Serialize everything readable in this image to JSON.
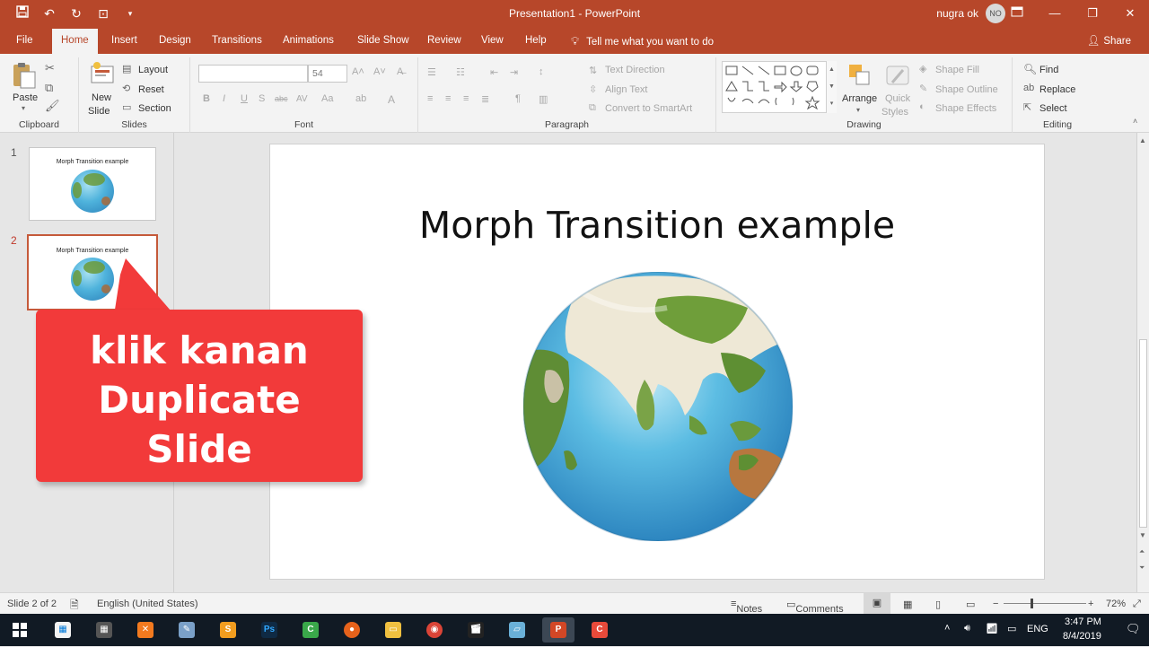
{
  "window": {
    "title": "Presentation1  -  PowerPoint",
    "user_name": "nugra ok",
    "user_initials": "NO"
  },
  "tabs": {
    "items": [
      "File",
      "Home",
      "Insert",
      "Design",
      "Transitions",
      "Animations",
      "Slide Show",
      "Review",
      "View",
      "Help"
    ],
    "active": "Home",
    "tell_me": "Tell me what you want to do",
    "share": "Share"
  },
  "ribbon": {
    "clipboard": {
      "label": "Clipboard",
      "paste": "Paste"
    },
    "slides": {
      "label": "Slides",
      "new_slide_1": "New",
      "new_slide_2": "Slide",
      "layout": "Layout",
      "reset": "Reset",
      "section": "Section"
    },
    "font": {
      "label": "Font",
      "font_name": "",
      "font_size": "54"
    },
    "paragraph": {
      "label": "Paragraph",
      "text_direction": "Text Direction",
      "align_text": "Align Text",
      "smartart": "Convert to SmartArt"
    },
    "drawing": {
      "label": "Drawing",
      "arrange": "Arrange",
      "quick_1": "Quick",
      "quick_2": "Styles",
      "shape_fill": "Shape Fill",
      "shape_outline": "Shape Outline",
      "shape_effects": "Shape Effects"
    },
    "editing": {
      "label": "Editing",
      "find": "Find",
      "replace": "Replace",
      "select": "Select"
    }
  },
  "thumbnails": [
    {
      "number": "1",
      "title": "Morph Transition example",
      "selected": false
    },
    {
      "number": "2",
      "title": "Morph Transition example",
      "selected": true
    }
  ],
  "slide": {
    "title": "Morph Transition example"
  },
  "callout": {
    "text": "klik kanan\nDuplicate\nSlide",
    "color": "#f23a3a"
  },
  "status": {
    "slide_pos": "Slide 2 of 2",
    "language": "English (United States)",
    "notes": "Notes",
    "comments": "Comments",
    "zoom": "72%"
  },
  "taskbar": {
    "language": "ENG",
    "time": "3:47 PM",
    "date": "8/4/2019"
  },
  "colors": {
    "accent": "#b7472a",
    "ribbon_bg": "#f3f3f3",
    "taskbar_bg": "#111a24"
  }
}
